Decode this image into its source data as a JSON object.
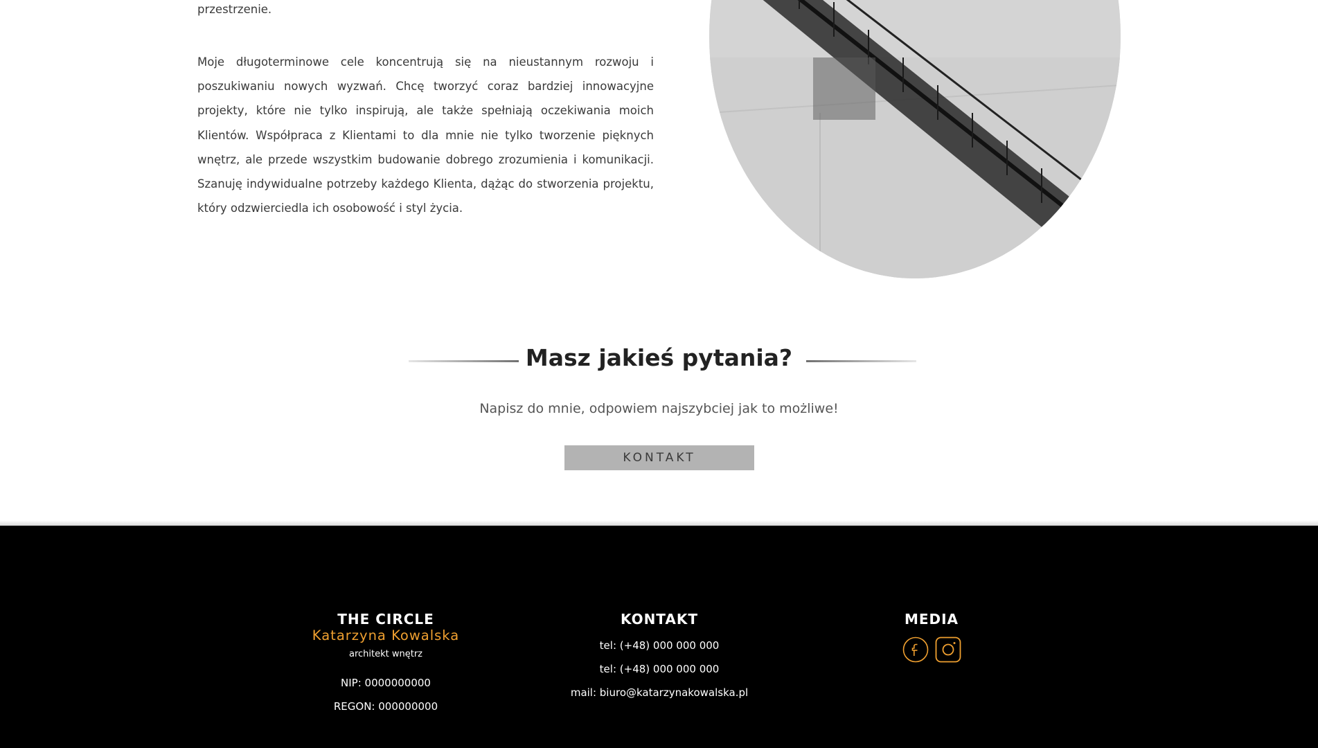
{
  "about": {
    "paragraph_end": "przestrzenie.",
    "paragraph_2": "Moje długoterminowe cele koncentrują się na nieustannym rozwoju i poszukiwaniu nowych wyzwań. Chcę tworzyć coraz bardziej innowacyjne projekty, które nie tylko inspirują, ale także spełniają oczekiwania moich Klientów. Współpraca z Klientami to dla mnie nie tylko tworzenie pięknych wnętrz, ale przede wszystkim budowanie dobrego zrozumienia i komunikacji. Szanuję indywidualne potrzeby każdego Klienta, dążąc do stworzenia projektu, który odzwierciedla ich osobowość i styl życia."
  },
  "cta": {
    "heading": "Masz jakieś pytania?",
    "subtext": "Napisz do mnie, odpowiem najszybciej jak to możliwe!",
    "button_label": "KONTAKT"
  },
  "footer": {
    "company": {
      "heading": "THE CIRCLE",
      "name": "Katarzyna Kowalska",
      "role": "architekt wnętrz",
      "nip": "NIP: 0000000000",
      "regon": "REGON: 000000000"
    },
    "contact": {
      "heading": "KONTAKT",
      "phone_1": "tel: (+48) 000 000 000",
      "phone_2": "tel: (+48) 000 000 000",
      "email": "mail: biuro@katarzynakowalska.pl"
    },
    "media": {
      "heading": "MEDIA",
      "icons": [
        "facebook-icon",
        "instagram-icon"
      ]
    }
  },
  "colors": {
    "accent": "#f0a030",
    "footer_bg": "#000000",
    "button_bg": "#b3b3b3"
  }
}
